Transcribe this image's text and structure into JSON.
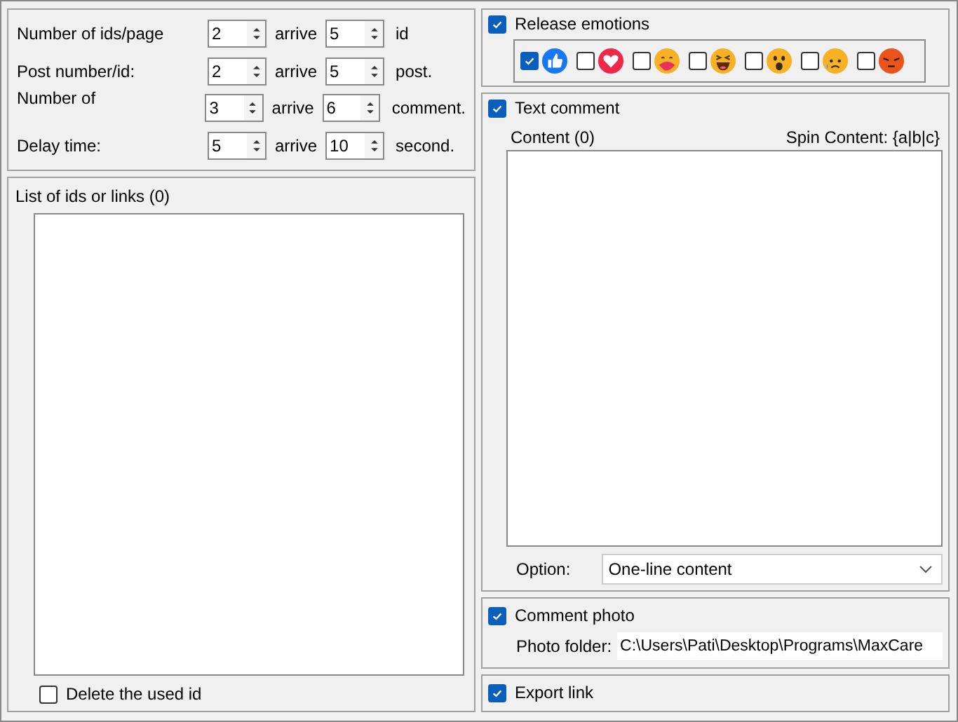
{
  "ranges": [
    {
      "label": "Number of ids/page",
      "from": "2",
      "joiner": "arrive",
      "to": "5",
      "unit": "id"
    },
    {
      "label": "Post number/id:",
      "from": "2",
      "joiner": "arrive",
      "to": "5",
      "unit": "post."
    },
    {
      "label": "Number of",
      "from": "3",
      "joiner": "arrive",
      "to": "6",
      "unit": "comment."
    },
    {
      "label": "Delay time:",
      "from": "5",
      "joiner": "arrive",
      "to": "10",
      "unit": "second."
    }
  ],
  "id_list": {
    "title": "List of ids or links (0)",
    "delete_used": {
      "label": "Delete the used id",
      "checked": false
    }
  },
  "emotions": {
    "label": "Release emotions",
    "checked": true,
    "reactions": [
      {
        "kind": "like",
        "checked": true
      },
      {
        "kind": "love",
        "checked": false
      },
      {
        "kind": "care",
        "checked": false
      },
      {
        "kind": "haha",
        "checked": false
      },
      {
        "kind": "wow",
        "checked": false
      },
      {
        "kind": "sad",
        "checked": false
      },
      {
        "kind": "angry",
        "checked": false
      }
    ]
  },
  "text_comment": {
    "label": "Text comment",
    "checked": true,
    "content_label": "Content (0)",
    "spin_hint": "Spin Content: {a|b|c}",
    "option_label": "Option:",
    "option_value": "One-line content"
  },
  "comment_photo": {
    "label": "Comment photo",
    "checked": true,
    "folder_label": "Photo folder:",
    "folder_value": "C:\\Users\\Pati\\Desktop\\Programs\\MaxCare"
  },
  "export_link": {
    "label": "Export link",
    "checked": true
  }
}
